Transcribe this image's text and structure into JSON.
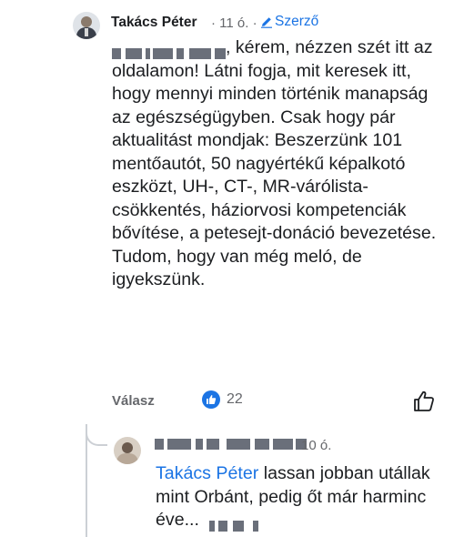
{
  "comment": {
    "author": "Takács Péter",
    "time": "11 ó.",
    "badge": "Szerző",
    "text_after_mention": ", kérem, nézzen szét itt az oldalamon! Látni fogja, mit keresek itt, hogy mennyi minden történik manapság az egészségügyben. Csak hogy pár aktualitást mondjak: Beszerzünk 101 mentőautót, 50 nagyértékű képalkotó eszközt, UH-, CT-, MR-várólista-csökkentés, háziorvosi kompetenciák bővítése, a petesejt-donáció bevezetése. Tudom, hogy van még meló, de igyekszünk.",
    "reply_action": "Válasz",
    "reaction_count": "22"
  },
  "reply": {
    "time": "10 ó.",
    "mention": "Takács Péter",
    "text": " lassan jobban utállak mint Orbánt, pedig őt már harminc éve..."
  },
  "colors": {
    "accent": "#1b74e4",
    "muted": "#65676b",
    "text": "#1c1e21"
  },
  "icons": {
    "badge": "pencil-icon",
    "reaction": "thumbs-up-icon",
    "like": "thumbs-up-outline-icon"
  }
}
